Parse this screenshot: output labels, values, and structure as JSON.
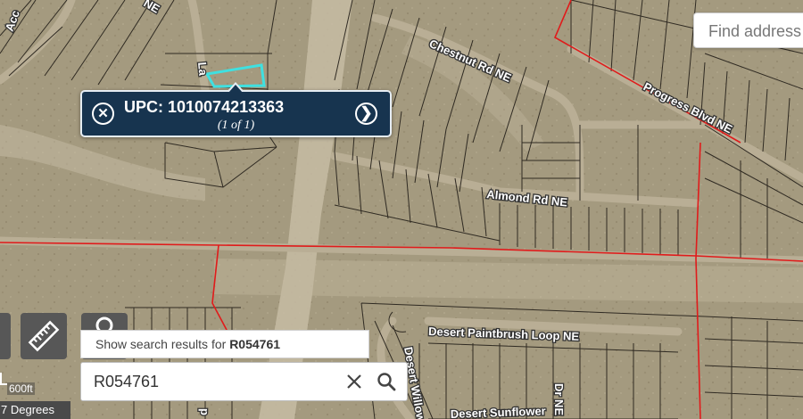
{
  "map": {
    "streets": {
      "chestnut": "Chestnut Rd NE",
      "progress": "Progress Blvd NE",
      "almond": "Almond Rd NE",
      "desert_paintbrush": "Desert Paintbrush Loop NE",
      "desert_sunflower": "Desert Sunflower",
      "desert_willow": "Desert Willow",
      "top_left_ne": "NE",
      "top_left_acc": "Acc",
      "la": "La",
      "dr_ne": "Dr NE",
      "p": "p"
    },
    "colors": {
      "terrain": "#a59a80",
      "parcel_line": "#2f2a22",
      "boundary": "#e01b1b",
      "selected_parcel": "#3fe0e0",
      "popup_bg": "#17344f"
    }
  },
  "find_address": {
    "placeholder": "Find address"
  },
  "popup": {
    "title": "UPC: 1010074213363",
    "subtitle": "(1 of 1)",
    "close_icon": "close-circle-icon",
    "next_icon": "chevron-right-circle-icon"
  },
  "search": {
    "results_prefix": "Show search results for",
    "results_term": "R054761",
    "value": "R054761",
    "clear_icon": "close-icon",
    "search_icon": "search-icon"
  },
  "tools": {
    "ruler_icon": "ruler-icon",
    "search_icon": "magnifier-icon"
  },
  "scale": {
    "label": "600ft"
  },
  "rotation": {
    "label": "7 Degrees"
  }
}
